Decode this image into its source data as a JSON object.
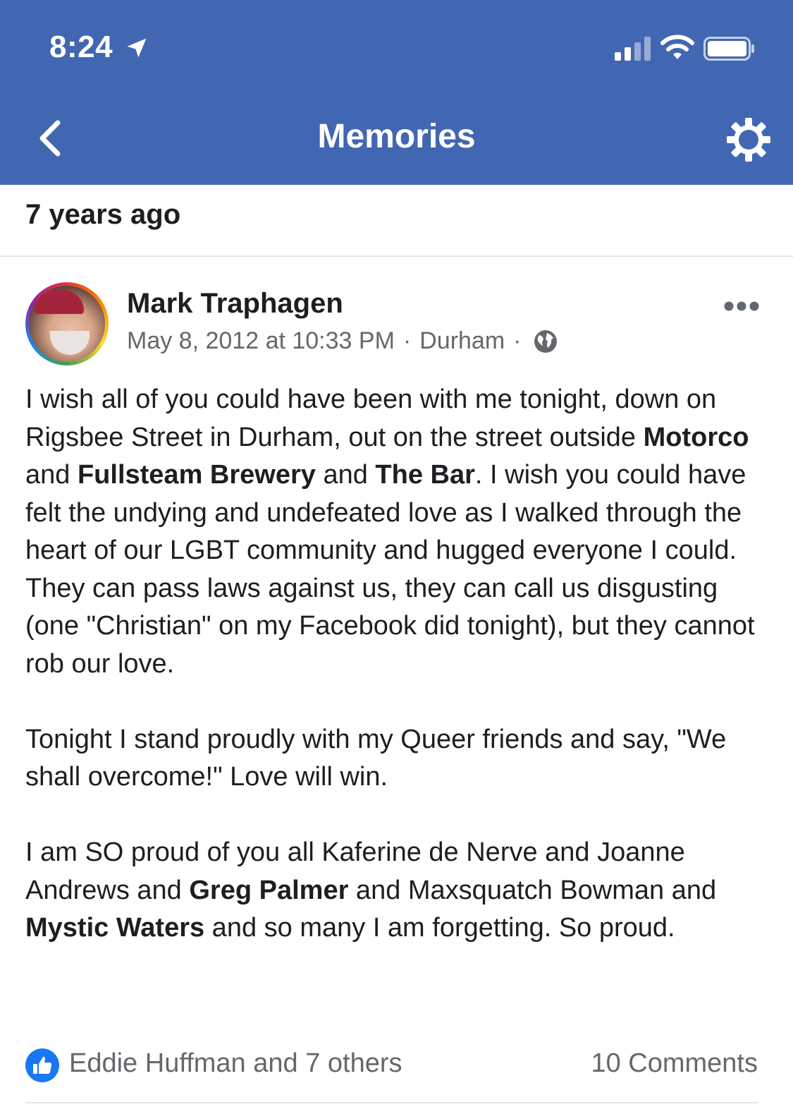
{
  "status_bar": {
    "time": "8:24"
  },
  "nav": {
    "title": "Memories",
    "back_icon": "chevron-left-icon",
    "settings_icon": "gear-icon"
  },
  "section": {
    "title": "7 years ago"
  },
  "post": {
    "author": "Mark Traphagen",
    "date": "May 8, 2012 at 10:33 PM",
    "location": "Durham",
    "privacy_icon": "globe-icon",
    "body": [
      [
        {
          "t": "I wish all of you could have been with me tonight, down on Rigsbee Street in Durham, out on the street outside "
        },
        {
          "t": "Motorco",
          "b": true
        },
        {
          "t": " and "
        },
        {
          "t": "Fullsteam Brewery",
          "b": true
        },
        {
          "t": " and "
        },
        {
          "t": "The Bar",
          "b": true
        },
        {
          "t": ". I wish you could have felt the undying and undefeated love as I walked through the heart of our LGBT community and hugged everyone I could. They can pass laws against us, they can call us disgusting (one \"Christian\" on my Facebook did tonight), but they cannot rob our love."
        }
      ],
      [
        {
          "t": "Tonight I stand proudly with my Queer friends and say, \"We shall overcome!\" Love will win."
        }
      ],
      [
        {
          "t": "I am SO proud of you all Kaferine de Nerve and Joanne Andrews and "
        },
        {
          "t": "Greg Palmer",
          "b": true
        },
        {
          "t": " and Maxsquatch Bowman and "
        },
        {
          "t": "Mystic Waters",
          "b": true
        },
        {
          "t": " and so many I am forgetting. So proud."
        }
      ]
    ],
    "likes": "Eddie Huffman and 7 others",
    "comments": "10 Comments"
  },
  "colors": {
    "brand": "#4267b2",
    "like_blue": "#1877f2",
    "secondary_text": "#65676b"
  }
}
